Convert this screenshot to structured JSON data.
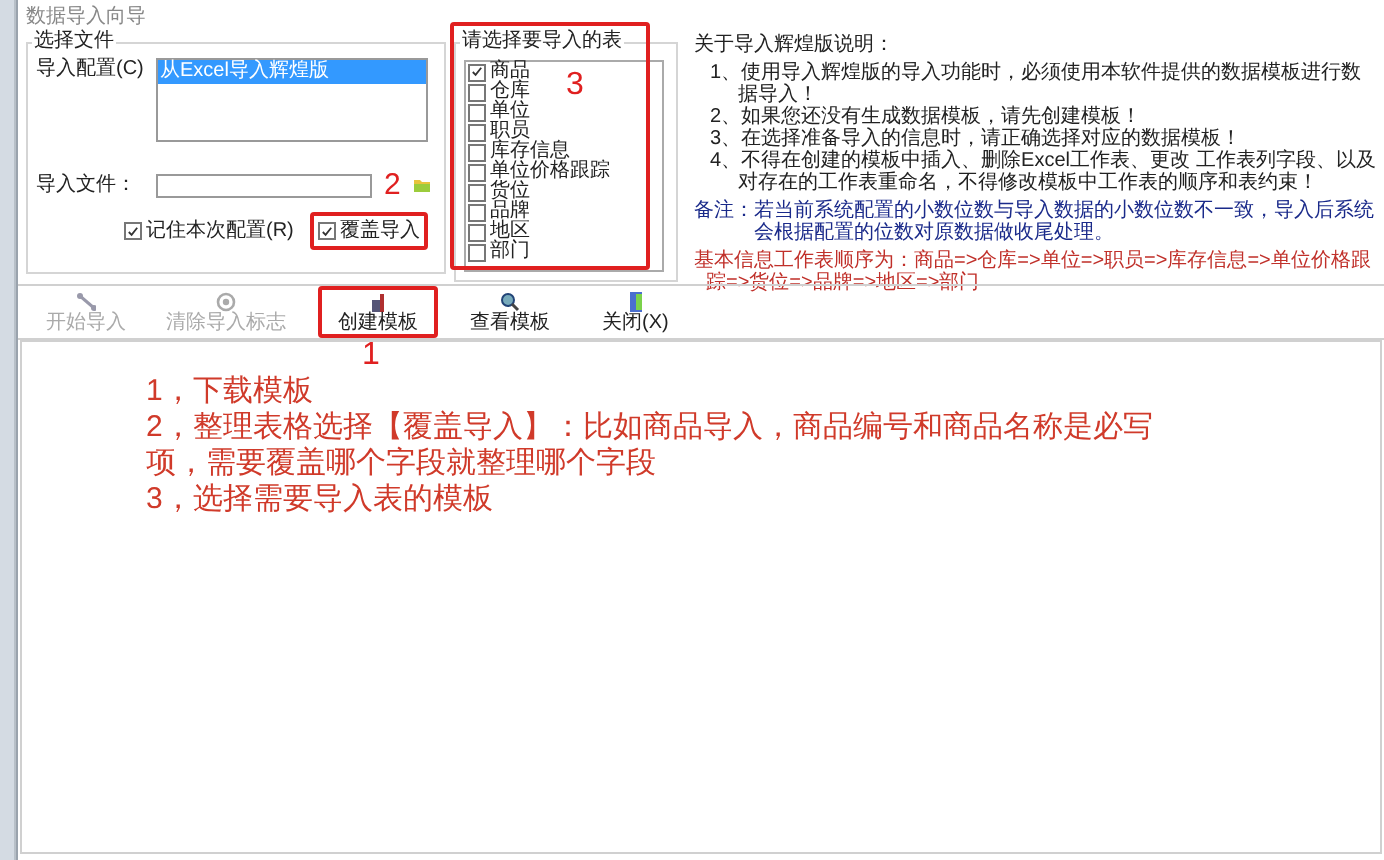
{
  "window": {
    "title": "数据导入向导"
  },
  "file_group": {
    "title": "选择文件",
    "config_label": "导入配置(C)",
    "configs": [
      {
        "label": "从Excel导入辉煌版",
        "selected": true
      }
    ],
    "file_label": "导入文件：",
    "options": [
      {
        "label": "记住本次配置(R)",
        "checked": true,
        "highlighted": false
      },
      {
        "label": "覆盖导入",
        "checked": true,
        "highlighted": true
      }
    ]
  },
  "tables": {
    "title": "请选择要导入的表",
    "items": [
      {
        "label": "商品",
        "checked": true
      },
      {
        "label": "仓库",
        "checked": false
      },
      {
        "label": "单位",
        "checked": false
      },
      {
        "label": "职员",
        "checked": false
      },
      {
        "label": "库存信息",
        "checked": false
      },
      {
        "label": "单位价格跟踪",
        "checked": false
      },
      {
        "label": "货位",
        "checked": false
      },
      {
        "label": "品牌",
        "checked": false
      },
      {
        "label": "地区",
        "checked": false
      },
      {
        "label": "部门",
        "checked": false
      }
    ]
  },
  "notes": {
    "title": "关于导入辉煌版说明：",
    "items": [
      "1、使用导入辉煌版的导入功能时，必须使用本软件提供的数据模板进行数据导入！",
      "2、如果您还没有生成数据模板，请先创建模板！",
      "3、在选择准备导入的信息时，请正确选择对应的数据模板！",
      "4、不得在创建的模板中插入、删除Excel工作表、更改 工作表列字段、以及对存在的工作表重命名，不得修改模板中工作表的顺序和表约束！"
    ],
    "remark": "备注：若当前系统配置的小数位数与导入数据的小数位数不一致，导入后系统会根据配置的位数对原数据做收尾处理。",
    "order": "基本信息工作表顺序为：商品=>仓库=>单位=>职员=>库存信息=>单位价格跟踪=>货位=>品牌=>地区=>部门"
  },
  "toolbar": [
    {
      "label": "开始导入",
      "kind": "start",
      "disabled": true,
      "highlighted": false
    },
    {
      "label": "清除导入标志",
      "kind": "clear",
      "disabled": true,
      "highlighted": false
    },
    {
      "label": "创建模板",
      "kind": "create",
      "disabled": false,
      "highlighted": true
    },
    {
      "label": "查看模板",
      "kind": "view",
      "disabled": false,
      "highlighted": false
    },
    {
      "label": "关闭(X)",
      "kind": "close",
      "disabled": false,
      "highlighted": false
    }
  ],
  "annotations": {
    "markers": [
      "1",
      "2",
      "3"
    ],
    "lines": [
      "1，下载模板",
      "2，整理表格选择【覆盖导入】：比如商品导入，商品编号和商品名称是必写项，需要覆盖哪个字段就整理哪个字段",
      "3，选择需要导入表的模板"
    ]
  }
}
